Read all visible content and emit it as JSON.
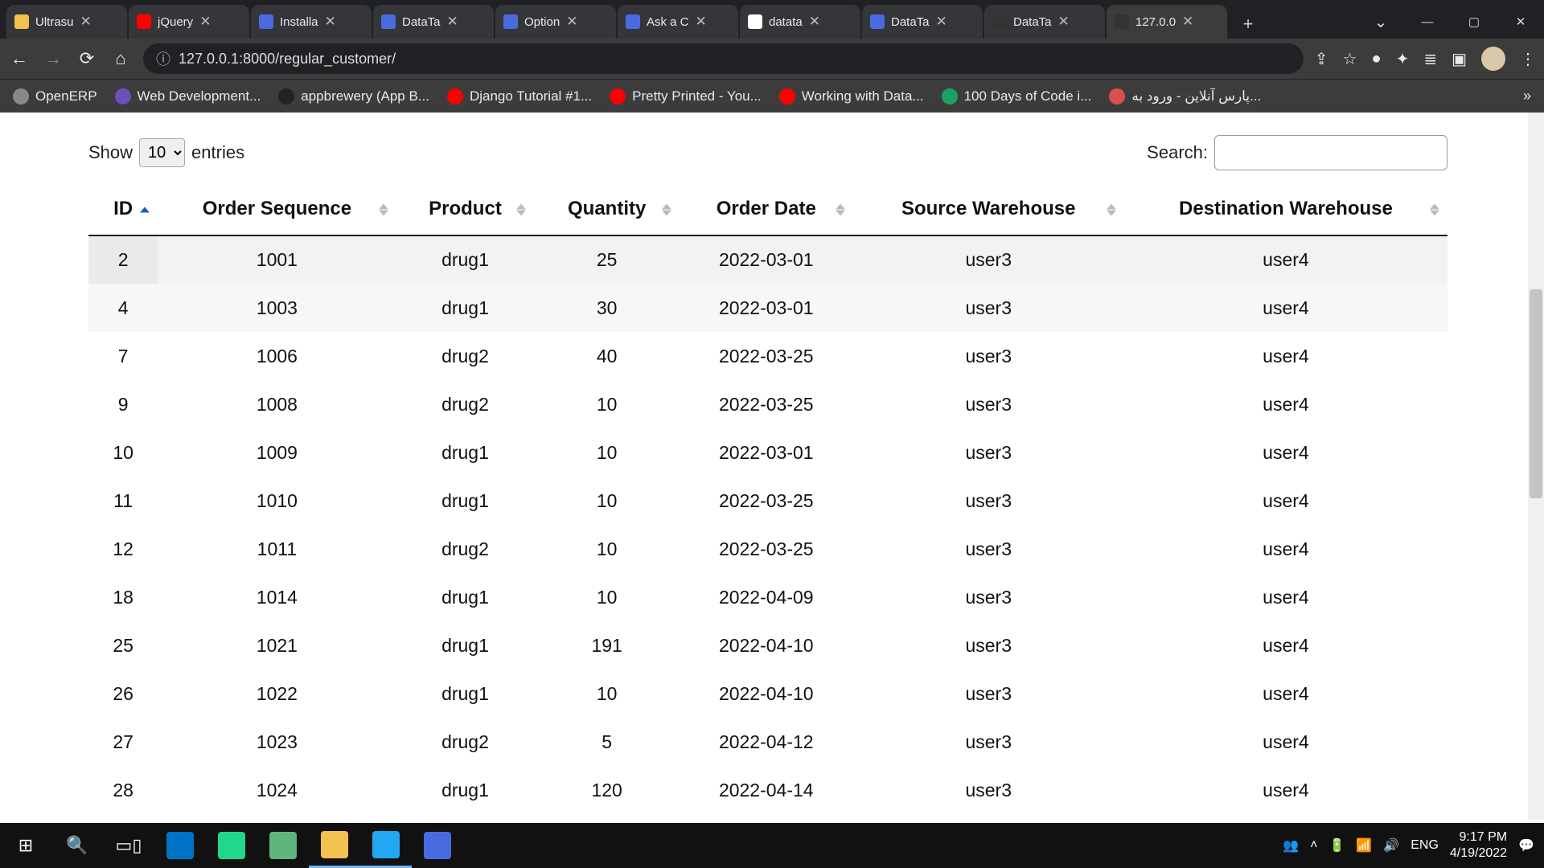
{
  "window": {
    "minimize": "—",
    "maximize": "▢",
    "close": "✕",
    "tabs_dropdown": "⌄"
  },
  "tabs": [
    {
      "title": "Ultrasu",
      "favicon": "#f2c14e"
    },
    {
      "title": "jQuery",
      "favicon": "#ff0000"
    },
    {
      "title": "Installa",
      "favicon": "#4a6bdf"
    },
    {
      "title": "DataTa",
      "favicon": "#4a6bdf"
    },
    {
      "title": "Option",
      "favicon": "#4a6bdf"
    },
    {
      "title": "Ask a C",
      "favicon": "#4a6bdf"
    },
    {
      "title": "datata",
      "favicon": "#ffffff"
    },
    {
      "title": "DataTa",
      "favicon": "#4a6bdf"
    },
    {
      "title": "DataTa",
      "favicon": "#333333"
    },
    {
      "title": "127.0.0",
      "favicon": "#333333",
      "active": true
    }
  ],
  "newtab": "+",
  "toolbar": {
    "back": "←",
    "forward": "→",
    "reload": "⟳",
    "home": "⌂",
    "info_icon": "ⓘ",
    "url": "127.0.0.1:8000/regular_customer/",
    "share": "⇪",
    "star": "☆",
    "profile_dot": "●",
    "ext": "✦",
    "list": "≣",
    "panel": "▣",
    "menu": "⋮"
  },
  "bookmarks": [
    {
      "label": "OpenERP",
      "color": "#888"
    },
    {
      "label": "Web Development...",
      "color": "#6b4fbb"
    },
    {
      "label": "appbrewery (App B...",
      "color": "#222"
    },
    {
      "label": "Django Tutorial #1...",
      "color": "#ff0000"
    },
    {
      "label": "Pretty Printed - You...",
      "color": "#ff0000"
    },
    {
      "label": "Working with Data...",
      "color": "#ff0000"
    },
    {
      "label": "100 Days of Code i...",
      "color": "#1aa260"
    },
    {
      "label": "پارس آنلاین - ورود به...",
      "color": "#d94f4f"
    }
  ],
  "bookmarks_more": "»",
  "datatable": {
    "length": {
      "show": "Show",
      "entries": "entries",
      "value": "10"
    },
    "search": {
      "label": "Search:",
      "value": ""
    },
    "columns": [
      {
        "label": "ID",
        "sorted_asc": true
      },
      {
        "label": "Order Sequence"
      },
      {
        "label": "Product"
      },
      {
        "label": "Quantity"
      },
      {
        "label": "Order Date"
      },
      {
        "label": "Source Warehouse"
      },
      {
        "label": "Destination Warehouse"
      }
    ],
    "rows": [
      {
        "id": "2",
        "seq": "1001",
        "product": "drug1",
        "qty": "25",
        "date": "2022-03-01",
        "src": "user3",
        "dst": "user4"
      },
      {
        "id": "4",
        "seq": "1003",
        "product": "drug1",
        "qty": "30",
        "date": "2022-03-01",
        "src": "user3",
        "dst": "user4"
      },
      {
        "id": "7",
        "seq": "1006",
        "product": "drug2",
        "qty": "40",
        "date": "2022-03-25",
        "src": "user3",
        "dst": "user4"
      },
      {
        "id": "9",
        "seq": "1008",
        "product": "drug2",
        "qty": "10",
        "date": "2022-03-25",
        "src": "user3",
        "dst": "user4"
      },
      {
        "id": "10",
        "seq": "1009",
        "product": "drug1",
        "qty": "10",
        "date": "2022-03-01",
        "src": "user3",
        "dst": "user4"
      },
      {
        "id": "11",
        "seq": "1010",
        "product": "drug1",
        "qty": "10",
        "date": "2022-03-25",
        "src": "user3",
        "dst": "user4"
      },
      {
        "id": "12",
        "seq": "1011",
        "product": "drug2",
        "qty": "10",
        "date": "2022-03-25",
        "src": "user3",
        "dst": "user4"
      },
      {
        "id": "18",
        "seq": "1014",
        "product": "drug1",
        "qty": "10",
        "date": "2022-04-09",
        "src": "user3",
        "dst": "user4"
      },
      {
        "id": "25",
        "seq": "1021",
        "product": "drug1",
        "qty": "191",
        "date": "2022-04-10",
        "src": "user3",
        "dst": "user4"
      },
      {
        "id": "26",
        "seq": "1022",
        "product": "drug1",
        "qty": "10",
        "date": "2022-04-10",
        "src": "user3",
        "dst": "user4"
      },
      {
        "id": "27",
        "seq": "1023",
        "product": "drug2",
        "qty": "5",
        "date": "2022-04-12",
        "src": "user3",
        "dst": "user4"
      },
      {
        "id": "28",
        "seq": "1024",
        "product": "drug1",
        "qty": "120",
        "date": "2022-04-14",
        "src": "user3",
        "dst": "user4"
      }
    ]
  },
  "taskbar": {
    "start": "⊞",
    "search": "🔍",
    "taskview": "▭▯",
    "people": "👥",
    "up": "˄",
    "battery": "🔋",
    "wifi": "📶",
    "sound": "🔊",
    "lang": "ENG",
    "notif": "💬",
    "time": "9:17 PM",
    "date": "4/19/2022",
    "apps": [
      {
        "name": "outlook",
        "color": "#0072c6"
      },
      {
        "name": "pycharm",
        "color": "#21d789"
      },
      {
        "name": "atom",
        "color": "#5fb57d"
      },
      {
        "name": "chrome",
        "color": "#f2c14e",
        "active": true
      },
      {
        "name": "vscode",
        "color": "#22a7f2",
        "active": true
      },
      {
        "name": "tool",
        "color": "#4a6bdf"
      }
    ]
  }
}
